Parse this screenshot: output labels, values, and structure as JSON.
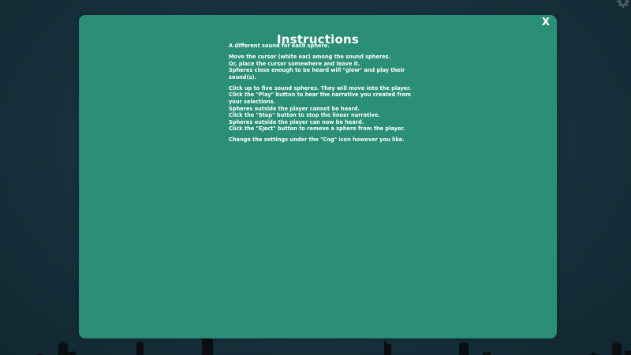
{
  "dialog": {
    "title": "Instructions",
    "close_label": "X"
  },
  "instructions": {
    "paragraphs": [
      [
        "A different sound for each sphere."
      ],
      [
        "Move the cursor (white ear) among the sound spheres.",
        "Or, place the cursor somewhere and leave it.",
        "Spheres close enough to be heard will \"glow\" and play their sound(s)."
      ],
      [
        "Click up to five sound spheres. They will move into the player.",
        "Click the \"Play\" button to hear the narrative you created from your selections.",
        "Spheres outside the player cannot be heard.",
        "Click the \"Stop\" button to stop the linear narrative.",
        "Spheres outside the player can now be heard.",
        "Click the \"Eject\" button to remove a sphere from the player."
      ],
      [
        "Change the settings under the \"Cog\" icon however you like."
      ]
    ]
  },
  "icons": {
    "settings": "gear-icon",
    "close": "close-icon"
  },
  "colors": {
    "background": "#16303b",
    "modal": "#2a8f76",
    "text": "#ffffff",
    "skyline": "#0b0f12"
  }
}
